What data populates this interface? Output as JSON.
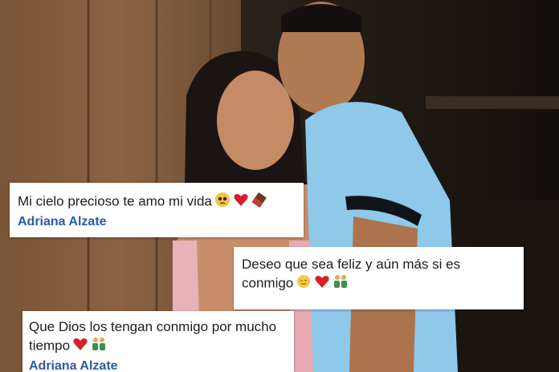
{
  "comments": [
    {
      "text": "Mi cielo precioso te amo mi vida",
      "author": "Adriana Alzate",
      "emojis": [
        "pleading-face-icon",
        "red-heart-icon",
        "chocolate-bar-icon"
      ]
    },
    {
      "text": "Deseo que sea feliz y aún más si es conmigo",
      "author": "",
      "emojis": [
        "sun-face-icon",
        "red-heart-icon",
        "couple-icon"
      ]
    },
    {
      "text": "Que Dios los tengan conmigo por mucho tiempo",
      "author": "Adriana Alzate",
      "emojis": [
        "red-heart-icon",
        "couple-icon"
      ]
    }
  ],
  "colors": {
    "author": "#2a5ba8",
    "heart": "#d81e2a",
    "card": "#ffffff"
  }
}
